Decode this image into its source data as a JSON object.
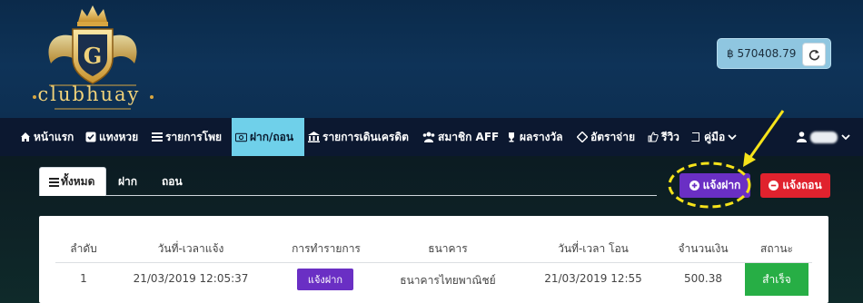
{
  "brand": {
    "logo_text": "clubhuay",
    "logo_emblem": "crown-shield-emblem"
  },
  "balance": {
    "currency_symbol": "฿",
    "amount": "570408.79",
    "refresh_icon": "refresh-icon"
  },
  "nav": {
    "items": [
      {
        "label": "หน้าแรก",
        "icon": "home-icon"
      },
      {
        "label": "แทงหวย",
        "icon": "checkbox-icon"
      },
      {
        "label": "รายการโพย",
        "icon": "list-icon"
      },
      {
        "label": "ฝาก/ถอน",
        "icon": "money-icon",
        "active": true
      },
      {
        "label": "รายการเดินเครดิต",
        "icon": "bank-icon"
      },
      {
        "label": "สมาชิก AFF",
        "icon": "users-icon"
      },
      {
        "label": "ผลรางวัล",
        "icon": "trophy-icon"
      },
      {
        "label": "อัตราจ่าย",
        "icon": "diamond-icon"
      },
      {
        "label": "รีวิว",
        "icon": "thumbs-up-icon"
      },
      {
        "label": "คู่มือ",
        "icon": "book-icon"
      }
    ],
    "user_icon": "user-icon"
  },
  "tabs": [
    {
      "label": "ทั้งหมด",
      "active": true
    },
    {
      "label": "ฝาก"
    },
    {
      "label": "ถอน"
    }
  ],
  "actions": {
    "deposit_label": "แจ้งฝาก",
    "withdraw_label": "แจ้งถอน",
    "accent_deposit": "#6a2fc4",
    "accent_withdraw": "#e0222e"
  },
  "table": {
    "headers": [
      "ลำดับ",
      "วันที่-เวลาแจ้ง",
      "การทำรายการ",
      "ธนาคาร",
      "วันที่-เวลา โอน",
      "จำนวนเงิน",
      "สถานะ"
    ],
    "rows": [
      {
        "index": "1",
        "notified_at": "21/03/2019 12:05:37",
        "type": "แจ้งฝาก",
        "bank": "ธนาคารไทยพาณิชย์",
        "transferred_at": "21/03/2019 12:55",
        "amount": "500.38",
        "status": "สำเร็จ",
        "status_color": "#27ae45"
      }
    ]
  }
}
